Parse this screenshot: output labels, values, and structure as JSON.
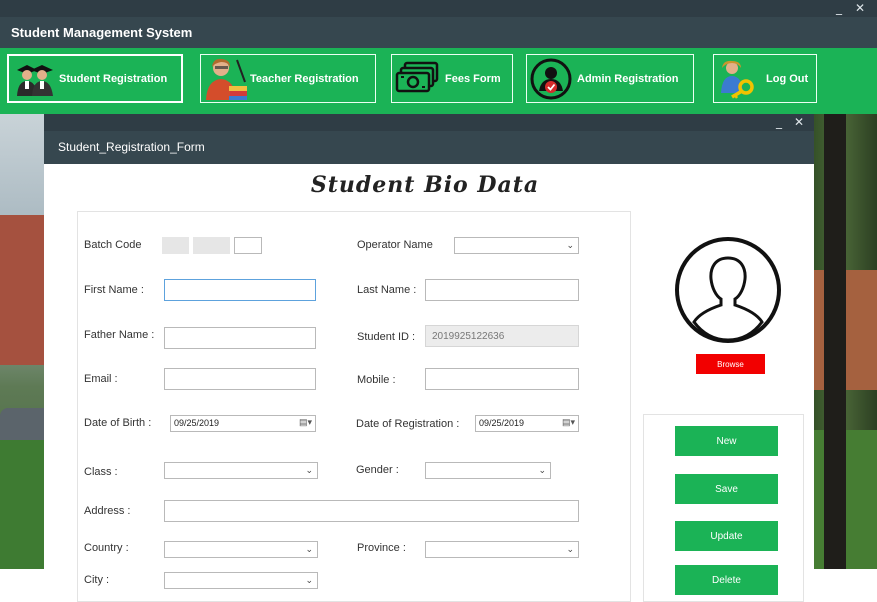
{
  "window": {
    "title": "Student Management System",
    "minimize": "_",
    "close": "✕"
  },
  "nav": {
    "items": [
      {
        "label": "Student Registration",
        "icon": "students-icon",
        "active": true
      },
      {
        "label": "Teacher Registration",
        "icon": "teacher-icon"
      },
      {
        "label": "Fees Form",
        "icon": "money-icon"
      },
      {
        "label": "Admin Registration",
        "icon": "admin-icon"
      },
      {
        "label": "Log Out",
        "icon": "logout-key-icon"
      }
    ]
  },
  "form_window": {
    "title": "Student_Registration_Form",
    "minimize": "_",
    "close": "✕"
  },
  "form": {
    "heading": "Student Bio Data",
    "batch_code": {
      "label": "Batch Code"
    },
    "operator_name": {
      "label": "Operator Name",
      "value": ""
    },
    "first_name": {
      "label": "First Name :",
      "value": ""
    },
    "last_name": {
      "label": "Last Name :",
      "value": ""
    },
    "father_name": {
      "label": "Father Name :",
      "value": ""
    },
    "student_id": {
      "label": "Student ID :",
      "value": "2019925122636"
    },
    "email": {
      "label": "Email :",
      "value": ""
    },
    "mobile": {
      "label": "Mobile :",
      "value": ""
    },
    "dob": {
      "label": "Date of Birth :",
      "value": "09/25/2019"
    },
    "dor": {
      "label": "Date of Registration :",
      "value": "09/25/2019"
    },
    "class": {
      "label": "Class :",
      "value": ""
    },
    "gender": {
      "label": "Gender :",
      "value": ""
    },
    "address": {
      "label": "Address :",
      "value": ""
    },
    "country": {
      "label": "Country :",
      "value": ""
    },
    "province": {
      "label": "Province :",
      "value": ""
    },
    "city": {
      "label": "City :",
      "value": ""
    }
  },
  "photo": {
    "icon": "user-avatar-icon",
    "browse_label": "Browse"
  },
  "actions": {
    "new": "New",
    "save": "Save",
    "update": "Update",
    "delete": "Delete"
  },
  "colors": {
    "accent": "#1bb356",
    "titlebar": "#36474f",
    "browse": "#f20000"
  }
}
